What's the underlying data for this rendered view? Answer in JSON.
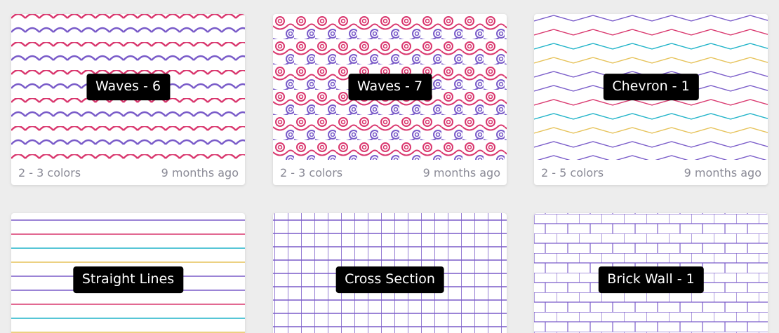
{
  "colors": {
    "pink": "#d9376e",
    "purple": "#7a5cc9",
    "teal": "#1fb3c8",
    "yellow": "#e6c259",
    "label_bg": "#000000",
    "page_bg": "#ededed"
  },
  "patterns": [
    {
      "label": "Waves - 6",
      "colors": "2 - 3 colors",
      "updated": "9 months ago",
      "icon": "waves-pattern"
    },
    {
      "label": "Waves - 7",
      "colors": "2 - 3 colors",
      "updated": "9 months ago",
      "icon": "swirl-waves-pattern"
    },
    {
      "label": "Chevron - 1",
      "colors": "2 - 5 colors",
      "updated": "9 months ago",
      "icon": "chevron-pattern"
    },
    {
      "label": "Straight Lines",
      "icon": "straight-lines-pattern"
    },
    {
      "label": "Cross Section",
      "icon": "grid-pattern"
    },
    {
      "label": "Brick Wall - 1",
      "icon": "brick-pattern"
    }
  ]
}
